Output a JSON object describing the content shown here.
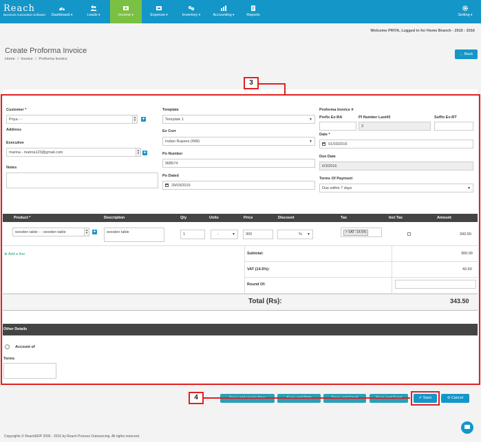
{
  "app": {
    "logo": "Reach",
    "logo_tagline": "Business Automation Software"
  },
  "nav": {
    "items": [
      {
        "label": "Dashboard"
      },
      {
        "label": "Leads"
      },
      {
        "label": "Income"
      },
      {
        "label": "Expense"
      },
      {
        "label": "Inventory"
      },
      {
        "label": "Accounting"
      },
      {
        "label": "Reports"
      }
    ],
    "setting": "Setting"
  },
  "welcome": "Welcome PRIYA, Logged in for Home Branch - 2015 - 2016",
  "page": {
    "title": "Create Proforma Invoice",
    "breadcrumb": [
      "Home",
      "/",
      "Invoice",
      "/",
      "Proforma Invoice"
    ],
    "back": "← Back"
  },
  "callouts": {
    "box3": "3",
    "box4": "4"
  },
  "form": {
    "customer_label": "Customer *",
    "customer_value": "Priya - -",
    "address_label": "Address",
    "executive_label": "Executive",
    "executive_value": "marina - marina123@gmail.com",
    "notes_label": "Notes",
    "template_label": "Template",
    "template_value": "Template 1",
    "excurr_label": "Ex Curr",
    "excurr_value": "Indian Rupees (INR)",
    "ponumber_label": "Po Number",
    "ponumber_value": "968574",
    "podated_label": "Po Dated",
    "podated_value": "29/03/2016",
    "proforma_label": "Proforma Invoice #",
    "prefix_label": "Prefix Ex:RA",
    "pinumber_label": "PI Number Last#2",
    "pinumber_value": "3",
    "suffix_label": "Suffix Ex:RT",
    "date_label": "Date *",
    "date_value": "01/03/2016",
    "duedate_label": "Due Date",
    "duedate_value": "6/3/2016",
    "terms_label": "Terms Of Payment",
    "terms_value": "Due within 7 days"
  },
  "table": {
    "headers": [
      "Product *",
      "Description",
      "Qty",
      "Units",
      "Price",
      "Discount",
      "Tax",
      "Incl Tax",
      "Amount"
    ],
    "row": {
      "product": "wooden table - - wooden table",
      "description": "wooden table",
      "qty": "1",
      "units": "-",
      "price": "300",
      "discount_unit": "%",
      "tax": "× VAT -14.5%",
      "amount": "343.50"
    },
    "add_line": "Add a line"
  },
  "summary": {
    "subtotal_label": "Subtotal:",
    "subtotal_value": "300.00",
    "vat_label": "VAT (14.5%):",
    "vat_value": "43.50",
    "roundof_label": "Round Of:",
    "total_label": "Total (Rs):",
    "total_value": "343.50"
  },
  "other": {
    "header": "Other Details",
    "account_label": "Account of",
    "terms_label": "Terms"
  },
  "buttons": {
    "save_create": "Save and create New",
    "save_print": "Save and Print",
    "save_email": "Save and Email",
    "save_send": "Save and Send",
    "save": "✔ Save",
    "cancel": "⊘ Cancel"
  },
  "footer": "Copyrights © ReachERP 2005 - 2016 by Reach Process Outsourcing. All rights reserved.",
  "colors": {
    "nav": "#1596c9",
    "active": "#7ac143",
    "annotation": "#e0201f",
    "table_header": "#444444"
  }
}
